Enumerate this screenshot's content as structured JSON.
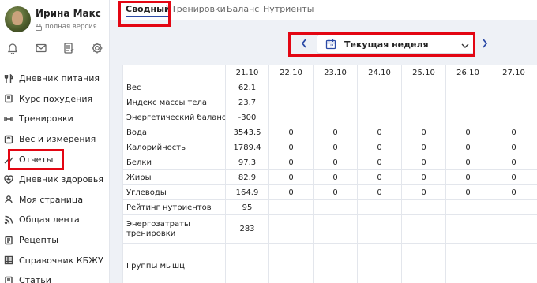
{
  "profile": {
    "name": "Ирина Макс",
    "version": "полная версия"
  },
  "top_icons": [
    "bell-icon",
    "mail-icon",
    "notes-icon",
    "gear-icon"
  ],
  "nav": {
    "items": [
      {
        "label": "Дневник питания",
        "icon": "cutlery-icon"
      },
      {
        "label": "Курс похудения",
        "icon": "book-icon"
      },
      {
        "label": "Тренировки",
        "icon": "dumbbell-icon"
      },
      {
        "label": "Вес и измерения",
        "icon": "scale-icon"
      },
      {
        "label": "Отчеты",
        "icon": "chart-icon"
      },
      {
        "label": "Дневник здоровья",
        "icon": "heart-icon"
      },
      {
        "label": "Моя страница",
        "icon": "person-icon"
      },
      {
        "label": "Общая лента",
        "icon": "feed-icon"
      },
      {
        "label": "Рецепты",
        "icon": "recipe-icon"
      },
      {
        "label": "Справочник КБЖУ",
        "icon": "table-icon"
      },
      {
        "label": "Статьи",
        "icon": "article-icon"
      }
    ]
  },
  "tabs": [
    "Сводный",
    "Тренировки",
    "Баланс",
    "Нутриенты"
  ],
  "week": {
    "label": "Текущая неделя"
  },
  "table": {
    "dates": [
      "21.10",
      "22.10",
      "23.10",
      "24.10",
      "25.10",
      "26.10",
      "27.10"
    ],
    "rows": [
      {
        "label": "Вес",
        "values": [
          "62.1",
          "",
          "",
          "",
          "",
          "",
          ""
        ]
      },
      {
        "label": "Индекс массы тела",
        "values": [
          "23.7",
          "",
          "",
          "",
          "",
          "",
          ""
        ]
      },
      {
        "label": "Энергетический баланс",
        "values": [
          "-300",
          "",
          "",
          "",
          "",
          "",
          ""
        ]
      },
      {
        "label": "Вода",
        "values": [
          "3543.5",
          "0",
          "0",
          "0",
          "0",
          "0",
          "0"
        ]
      },
      {
        "label": "Калорийность",
        "values": [
          "1789.4",
          "0",
          "0",
          "0",
          "0",
          "0",
          "0"
        ]
      },
      {
        "label": "Белки",
        "values": [
          "97.3",
          "0",
          "0",
          "0",
          "0",
          "0",
          "0"
        ]
      },
      {
        "label": "Жиры",
        "values": [
          "82.9",
          "0",
          "0",
          "0",
          "0",
          "0",
          "0"
        ]
      },
      {
        "label": "Углеводы",
        "values": [
          "164.9",
          "0",
          "0",
          "0",
          "0",
          "0",
          "0"
        ]
      },
      {
        "label": "Рейтинг нутриентов",
        "values": [
          "95",
          "",
          "",
          "",
          "",
          "",
          ""
        ]
      },
      {
        "label": "Энергозатраты тренировки",
        "values": [
          "283",
          "",
          "",
          "",
          "",
          "",
          ""
        ]
      },
      {
        "label": "Группы мышц",
        "values": [
          "",
          "",
          "",
          "",
          "",
          "",
          ""
        ]
      }
    ]
  },
  "colors": {
    "accent": "#2b4aa6",
    "highlight": "#e30613"
  }
}
